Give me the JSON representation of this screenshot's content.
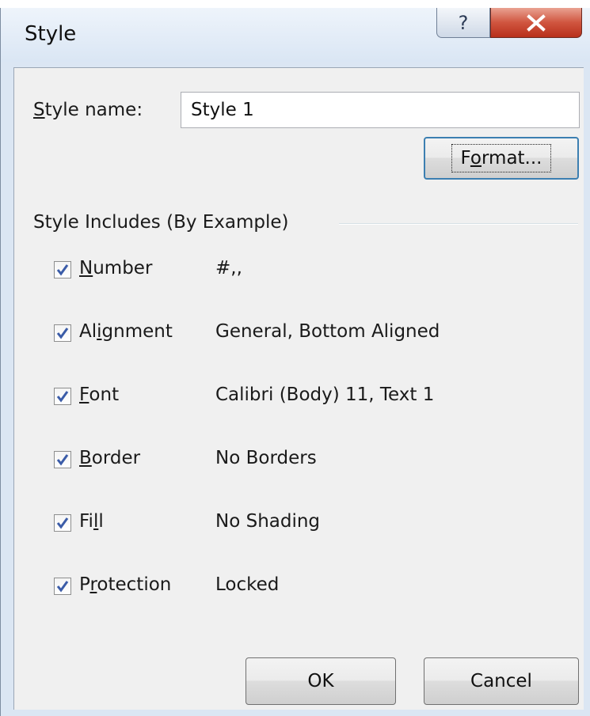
{
  "window": {
    "title": "Style",
    "help_glyph": "?",
    "close_glyph": "X"
  },
  "style_name": {
    "label_underlined": "S",
    "label_rest": "tyle name:",
    "value": "Style 1"
  },
  "format_button": {
    "pre": "F",
    "underlined": "o",
    "post": "rmat..."
  },
  "group": {
    "title": "Style Includes (By Example)"
  },
  "items": [
    {
      "pre": "",
      "underlined": "N",
      "post": "umber",
      "value": "#,,",
      "checked": true
    },
    {
      "pre": "Al",
      "underlined": "i",
      "post": "gnment",
      "value": "General, Bottom Aligned",
      "checked": true
    },
    {
      "pre": "",
      "underlined": "F",
      "post": "ont",
      "value": "Calibri (Body) 11, Text 1",
      "checked": true
    },
    {
      "pre": "",
      "underlined": "B",
      "post": "order",
      "value": "No Borders",
      "checked": true
    },
    {
      "pre": "Fi",
      "underlined": "l",
      "post": "l",
      "value": "No Shading",
      "checked": true
    },
    {
      "pre": "P",
      "underlined": "r",
      "post": "otection",
      "value": "Locked",
      "checked": true
    }
  ],
  "buttons": {
    "ok": "OK",
    "cancel": "Cancel"
  },
  "colors": {
    "checkmark": "#3b5ca8",
    "close_button": "#c7432c",
    "focus_border": "#3c7fb1"
  },
  "icons": {
    "help": "question-mark-icon",
    "close": "close-x-icon",
    "checkbox": "checkmark-icon"
  }
}
